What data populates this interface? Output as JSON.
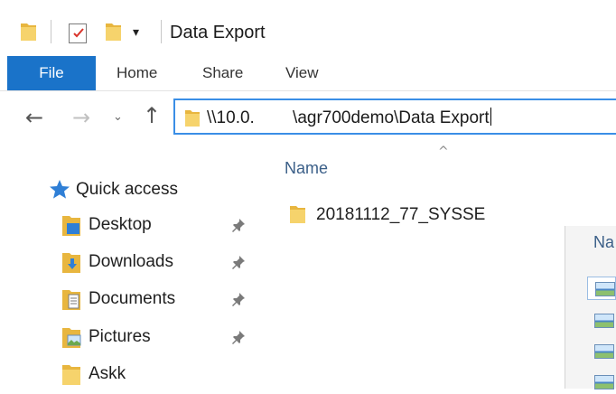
{
  "window": {
    "title": "Data Export"
  },
  "quick_access_toolbar": {
    "dropdown_glyph": "▾"
  },
  "ribbon": {
    "tabs": [
      "File",
      "Home",
      "Share",
      "View"
    ]
  },
  "navigation": {
    "back_glyph": "←",
    "forward_glyph": "→",
    "recent_glyph": "⌄",
    "up_glyph": "↑"
  },
  "address_bar": {
    "path": "\\\\10.0.        \\agr700demo\\Data Export"
  },
  "sidebar": {
    "quick_access_label": "Quick access",
    "items": [
      {
        "label": "Desktop",
        "icon": "desktop-folder-icon",
        "pinned": true
      },
      {
        "label": "Downloads",
        "icon": "downloads-folder-icon",
        "pinned": true
      },
      {
        "label": "Documents",
        "icon": "documents-folder-icon",
        "pinned": true
      },
      {
        "label": "Pictures",
        "icon": "pictures-folder-icon",
        "pinned": true
      },
      {
        "label": "Askk",
        "icon": "folder-icon",
        "pinned": false
      }
    ]
  },
  "file_list": {
    "sort_glyph": "^",
    "column_header": "Name",
    "items": [
      {
        "name": "20181112_77_SYSSE",
        "type": "folder"
      }
    ]
  },
  "background_window": {
    "column_header_partial": "Na",
    "thumbnail_count": 4
  },
  "colors": {
    "accent": "#1a73c9",
    "address_border": "#3a8ee6",
    "column_header": "#3b5f88",
    "folder_yellow": "#f2c94c"
  }
}
